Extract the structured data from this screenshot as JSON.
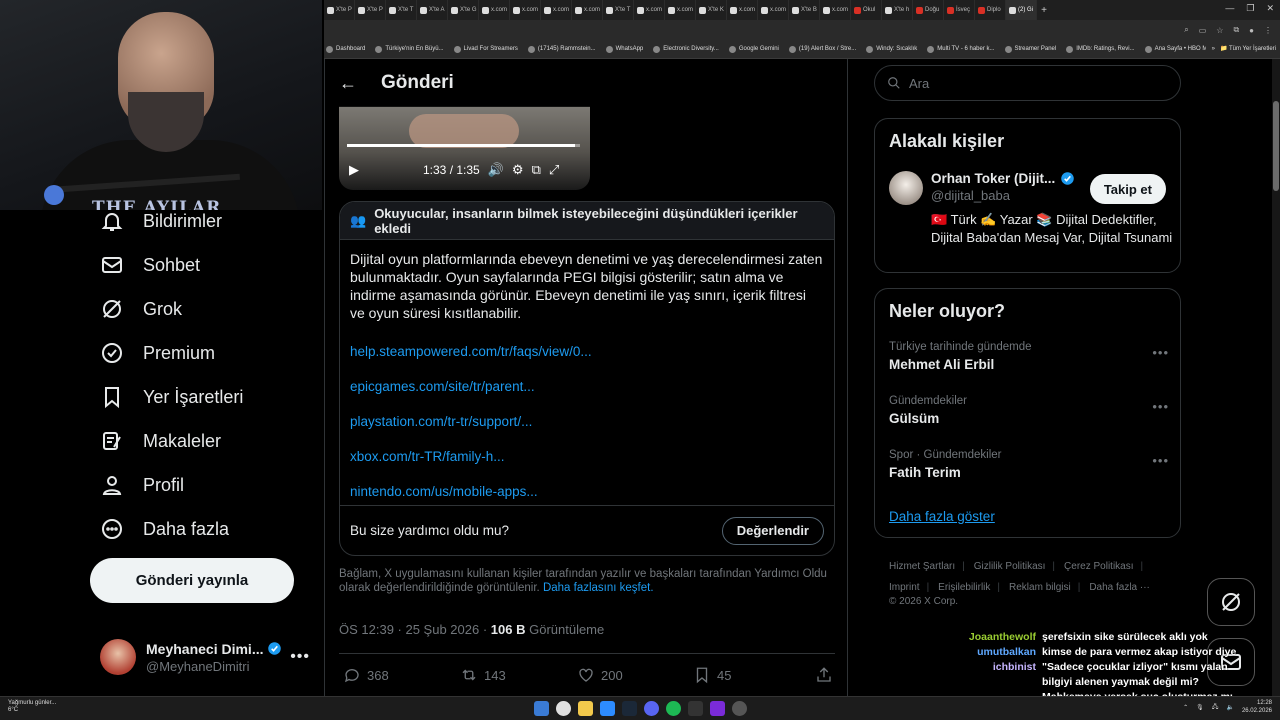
{
  "browser": {
    "tabs": [
      {
        "label": "X'te P",
        "fav": "x"
      },
      {
        "label": "X'te P",
        "fav": "x"
      },
      {
        "label": "X'te T",
        "fav": "x"
      },
      {
        "label": "X'te A",
        "fav": "x"
      },
      {
        "label": "X'te G",
        "fav": "x"
      },
      {
        "label": "x.com",
        "fav": "x"
      },
      {
        "label": "x.com",
        "fav": "x"
      },
      {
        "label": "x.com",
        "fav": "x"
      },
      {
        "label": "x.com",
        "fav": "x"
      },
      {
        "label": "X'te T",
        "fav": "x"
      },
      {
        "label": "x.com",
        "fav": "x"
      },
      {
        "label": "x.com",
        "fav": "x"
      },
      {
        "label": "X'te K",
        "fav": "x"
      },
      {
        "label": "x.com",
        "fav": "x"
      },
      {
        "label": "x.com",
        "fav": "x"
      },
      {
        "label": "X'te B",
        "fav": "x"
      },
      {
        "label": "x.com",
        "fav": "x"
      },
      {
        "label": "Okul",
        "fav": "red"
      },
      {
        "label": "X'te h",
        "fav": "x"
      },
      {
        "label": "Doğu",
        "fav": "red"
      },
      {
        "label": "İsveç",
        "fav": "red"
      },
      {
        "label": "Diplo",
        "fav": "red"
      },
      {
        "label": "(2) Gi",
        "fav": "x"
      }
    ],
    "new_tab": "+",
    "bookmarks": [
      "Dashboard",
      "Türkiye'nin En Büyü...",
      "Livad For Streamers",
      "(17145) Rammstein...",
      "WhatsApp",
      "Electronic Diversity...",
      "Google Gemini",
      "(19) Alert Box / Stre...",
      "Windy: Sıcaklık",
      "Multi TV - 6 haber k...",
      "Streamer Panel",
      "IMDb: Ratings, Revi...",
      "Ana Sayfa • HBO Max"
    ],
    "bookmarks_more": "»",
    "bookmarks_folder": "Tüm Yer İşaretleri"
  },
  "webcam": {
    "overlay_text": "THE AYILAR"
  },
  "leftnav": {
    "items": [
      {
        "label": "Bildirimler",
        "icon": "bell-icon"
      },
      {
        "label": "Sohbet",
        "icon": "mail-icon"
      },
      {
        "label": "Grok",
        "icon": "grok-icon"
      },
      {
        "label": "Premium",
        "icon": "premium-icon"
      },
      {
        "label": "Yer İşaretleri",
        "icon": "bookmark-icon"
      },
      {
        "label": "Makaleler",
        "icon": "article-icon"
      },
      {
        "label": "Profil",
        "icon": "profile-icon"
      },
      {
        "label": "Daha fazla",
        "icon": "more-circle-icon"
      }
    ],
    "post_button": "Gönderi yayınla",
    "account": {
      "name": "Meyhaneci Dimi...",
      "handle": "@MeyhaneDimitri",
      "more": "•••"
    }
  },
  "post": {
    "header_title": "Gönderi",
    "video": {
      "time": "1:33 / 1:35",
      "progress": 0.98
    },
    "community_note": {
      "header": "Okuyucular, insanların bilmek isteyebileceğini düşündükleri içerikler ekledi",
      "body": "Dijital oyun platformlarında ebeveyn denetimi ve yaş derecelendirmesi zaten bulunmaktadır. Oyun sayfalarında PEGI bilgisi gösterilir; satın alma ve indirme aşamasında görünür. Ebeveyn denetimi ile yaş sınırı, içerik filtresi ve oyun süresi kısıtlanabilir.",
      "links": [
        "help.steampowered.com/tr/faqs/view/0...",
        "epicgames.com/site/tr/parent...",
        "playstation.com/tr-tr/support/...",
        "xbox.com/tr-TR/family-h...",
        "nintendo.com/us/mobile-apps..."
      ],
      "helpful_question": "Bu size yardımcı oldu mu?",
      "rate_button": "Değerlendir"
    },
    "disclaimer": "Bağlam, X uygulamasını kullanan kişiler tarafından yazılır ve başkaları tarafından Yardımcı Oldu olarak değerlendirildiğinde görüntülenir.",
    "disclaimer_link": "Daha fazlasını keşfet.",
    "timestamp": "ÖS 12:39 · 25 Şub 2026 · ",
    "views_count": "106 B",
    "views_label": " Görüntüleme",
    "actions": {
      "replies": "368",
      "reposts": "143",
      "likes": "200",
      "bookmarks": "45"
    }
  },
  "right": {
    "search_placeholder": "Ara",
    "related": {
      "title": "Alakalı kişiler",
      "name": "Orhan Toker (Dijit...",
      "handle": "@dijital_baba",
      "follow_button": "Takip et",
      "bio": "🇹🇷 Türk ✍️ Yazar 📚 Dijital Dedektifler, Dijital Baba'dan Mesaj Var, Dijital Tsunami"
    },
    "trends": {
      "title": "Neler oluyor?",
      "items": [
        {
          "context": "Türkiye tarihinde gündemde",
          "name": "Mehmet Ali Erbil"
        },
        {
          "context": "Gündemdekiler",
          "name": "Gülsüm"
        },
        {
          "context": "Spor · Gündemdekiler",
          "name": "Fatih Terim"
        }
      ],
      "show_more": "Daha fazla göster"
    },
    "footer_links": [
      "Hizmet Şartları",
      "Gizlilik Politikası",
      "Çerez Politikası",
      "Imprint",
      "Erişilebilirlik",
      "Reklam bilgisi",
      "Daha fazla ···"
    ],
    "copyright": "© 2026 X Corp."
  },
  "chat": [
    {
      "user": "Joaanthewolf",
      "color": "#9acd32",
      "text": "şerefsixin sike sürülecek aklı yok"
    },
    {
      "user": "umutbalkan",
      "color": "#5fa8ff",
      "text": "kimse de para vermez akap istiyor diye"
    },
    {
      "user": "ichbinist",
      "color": "#c7b6ff",
      "text": "\"Sadece çocuklar izliyor\" kısmı yalan bilgiyi alenen yaymak değil mi? Mahkemeye versek suç oluşturmaz mı"
    }
  ],
  "taskbar": {
    "weather_title": "Yağmurlu günler...",
    "weather_temp": "6°C",
    "time": "12:28",
    "date": "26.02.2026"
  },
  "colors": {
    "accent": "#1d9bf0",
    "background": "#000000",
    "border": "#2f3336",
    "muted": "#71767b"
  }
}
